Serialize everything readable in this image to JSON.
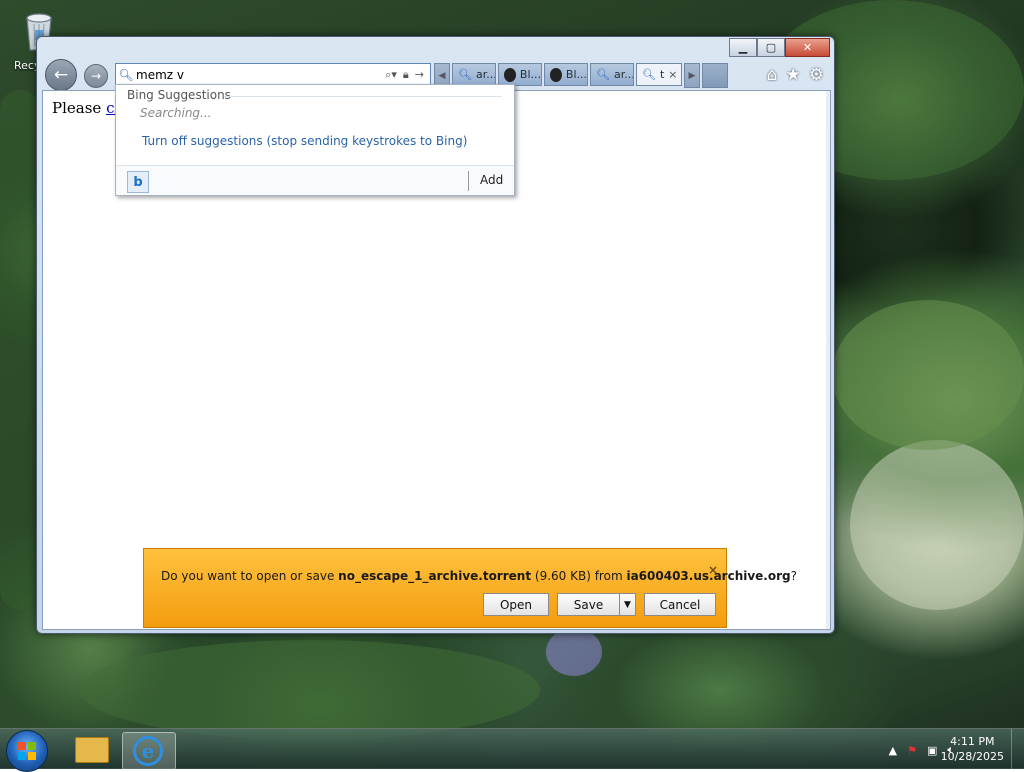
{
  "desktop": {
    "recycle_bin_label": "Recy"
  },
  "browser": {
    "address_text": "memz v",
    "tabs": [
      {
        "label": "ar...",
        "icon": "search-icon"
      },
      {
        "label": "Bl...",
        "icon": "github-icon"
      },
      {
        "label": "Bl...",
        "icon": "github-icon"
      },
      {
        "label": "ar...",
        "icon": "search-icon"
      },
      {
        "label": "t",
        "icon": "search-icon",
        "active": true
      }
    ],
    "page_text": "Please ",
    "page_link": "cli",
    "suggestions": {
      "header": "Bing Suggestions",
      "status": "Searching...",
      "turn_off": "Turn off suggestions (stop sending keystrokes to Bing)",
      "add": "Add",
      "provider_letter": "b"
    }
  },
  "notification": {
    "prefix": "Do you want to open or save ",
    "filename": "no_escape_1_archive.torrent",
    "size": " (9.60 KB) from ",
    "host": "ia600403.us.archive.org",
    "suffix": "?",
    "open_label": "Open",
    "save_label": "Save",
    "cancel_label": "Cancel",
    "close_glyph": "×"
  },
  "taskbar": {
    "time": "4:11 PM",
    "date": "10/28/2025"
  },
  "colors": {
    "notify_bar": "#f8a81e",
    "link": "#2a63a9"
  }
}
